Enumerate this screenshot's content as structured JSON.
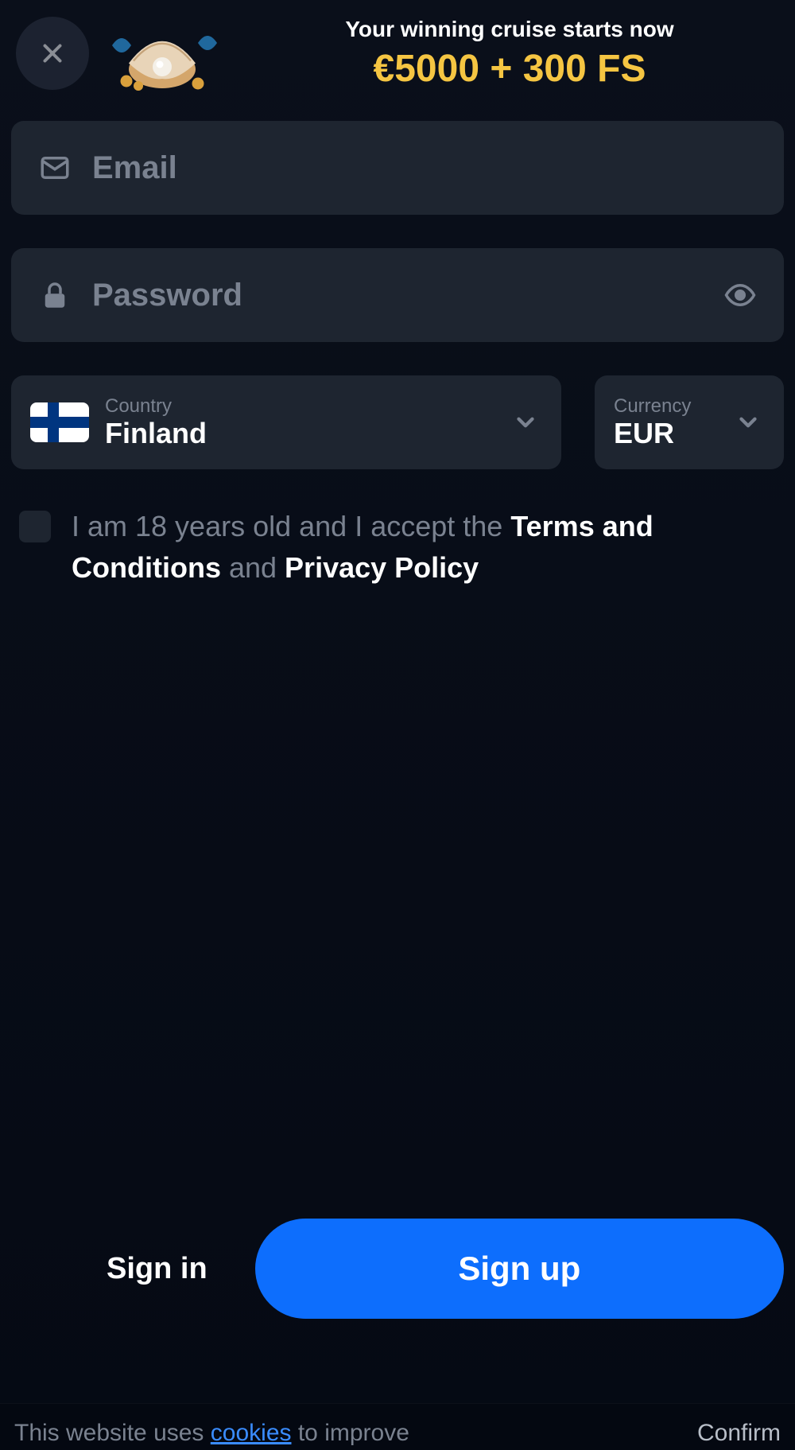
{
  "header": {
    "promo_title": "Your winning cruise starts now",
    "promo_bonus": "€5000 + 300 FS"
  },
  "form": {
    "email_placeholder": "Email",
    "password_placeholder": "Password",
    "country_label": "Country",
    "country_value": "Finland",
    "currency_label": "Currency",
    "currency_value": "EUR"
  },
  "terms": {
    "prefix": "I am 18 years old and I accept the ",
    "terms_link": "Terms and Conditions",
    "and": " and ",
    "privacy_link": "Privacy Policy"
  },
  "footer": {
    "signin_label": "Sign in",
    "signup_label": "Sign up"
  },
  "cookie": {
    "prefix": "This website uses ",
    "link": "cookies",
    "suffix": " to improve",
    "confirm": "Confirm"
  }
}
